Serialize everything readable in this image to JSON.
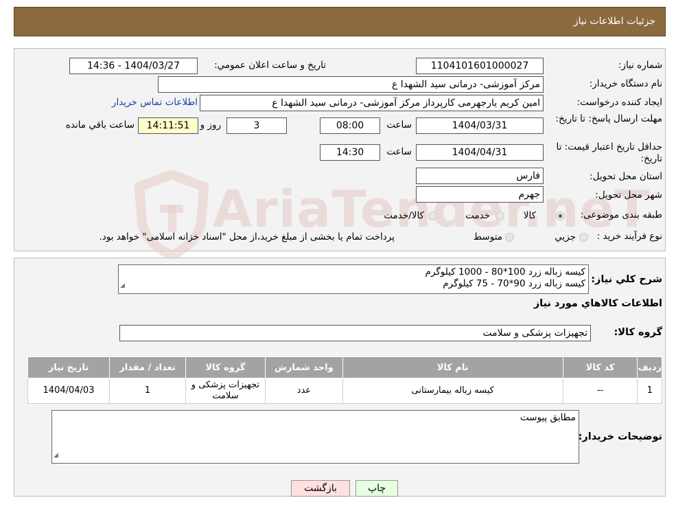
{
  "header": {
    "title": "جزئیات اطلاعات نیاز"
  },
  "labels": {
    "need_number": "شماره نیاز:",
    "announce_datetime": "تاریخ و ساعت اعلان عمومي:",
    "buyer_org": "نام دستگاه خریدار:",
    "requester": "ایجاد کننده درخواست:",
    "contact_link": "اطلاعات تماس خریدار",
    "deadline": "مهلت ارسال پاسخ: تا تاریخ:",
    "time": "ساعت",
    "day_and": "روز و",
    "remaining": "ساعت باقي مانده",
    "min_validity": "حداقل تاریخ اعتبار قیمت: تا تاریخ:",
    "province": "استان محل تحویل:",
    "city": "شهر محل تحویل:",
    "category": "طبقه بندی موضوعی:",
    "purchase_type": "نوع فرآیند خرید :",
    "description": "شرح کلي نیاز:",
    "goods_info": "اطلاعات کالاهاي مورد نیاز",
    "goods_group": "گروه کالا:",
    "buyer_notes": "توضیحات خریدار:"
  },
  "values": {
    "need_number": "1104101601000027",
    "announce_datetime": "1404/03/27 - 14:36",
    "buyer_org": "مرکز آموزشی- درمانی سید الشهدا ع",
    "requester": "امین کریم یارجهرمی کارپرداز مرکز آموزشی- درمانی سید الشهدا ع",
    "deadline_date": "1404/03/31",
    "deadline_time": "08:00",
    "days": "3",
    "remaining_time": "14:11:51",
    "validity_date": "1404/04/31",
    "validity_time": "14:30",
    "province": "فارس",
    "city": "جهرم",
    "description_line1": "کیسه زباله زرد 100*80 - 1000 کیلوگرم",
    "description_line2": "کیسه زباله زرد 90*70  - 75 کیلوگرم",
    "goods_group": "تجهیزات پزشکی و سلامت",
    "buyer_notes": "مطابق پیوست"
  },
  "category_options": [
    {
      "label": "کالا",
      "selected": true
    },
    {
      "label": "خدمت",
      "selected": false
    },
    {
      "label": "کالا/خدمت",
      "selected": false
    }
  ],
  "purchase_options": [
    {
      "label": "جزيي",
      "selected": false
    },
    {
      "label": "متوسط",
      "selected": false
    }
  ],
  "purchase_note": "پرداخت تمام یا بخشی از مبلغ خرید،از محل \"اسناد خزانه اسلامی\" خواهد بود.",
  "table": {
    "headers": [
      "ردیف",
      "کد کالا",
      "نام کالا",
      "واحد شمارش",
      "گروه کالا",
      "تعداد / مقدار",
      "تاریخ نیاز"
    ],
    "rows": [
      [
        "1",
        "--",
        "کیسه زباله بیمارستانی",
        "عدد",
        "تجهیزات پزشکی و سلامت",
        "1",
        "1404/04/03"
      ]
    ]
  },
  "buttons": {
    "print": "چاپ",
    "back": "بازگشت"
  },
  "watermark": "AriaTender.neT",
  "colors": {
    "header_bg": "#8b6a3e",
    "table_header_bg": "#a3a3a3",
    "remaining_bg": "#ffffcc",
    "back_btn_bg": "#ffe0e0",
    "print_btn_bg": "#e6ffe0",
    "link": "#1a3fb0"
  }
}
